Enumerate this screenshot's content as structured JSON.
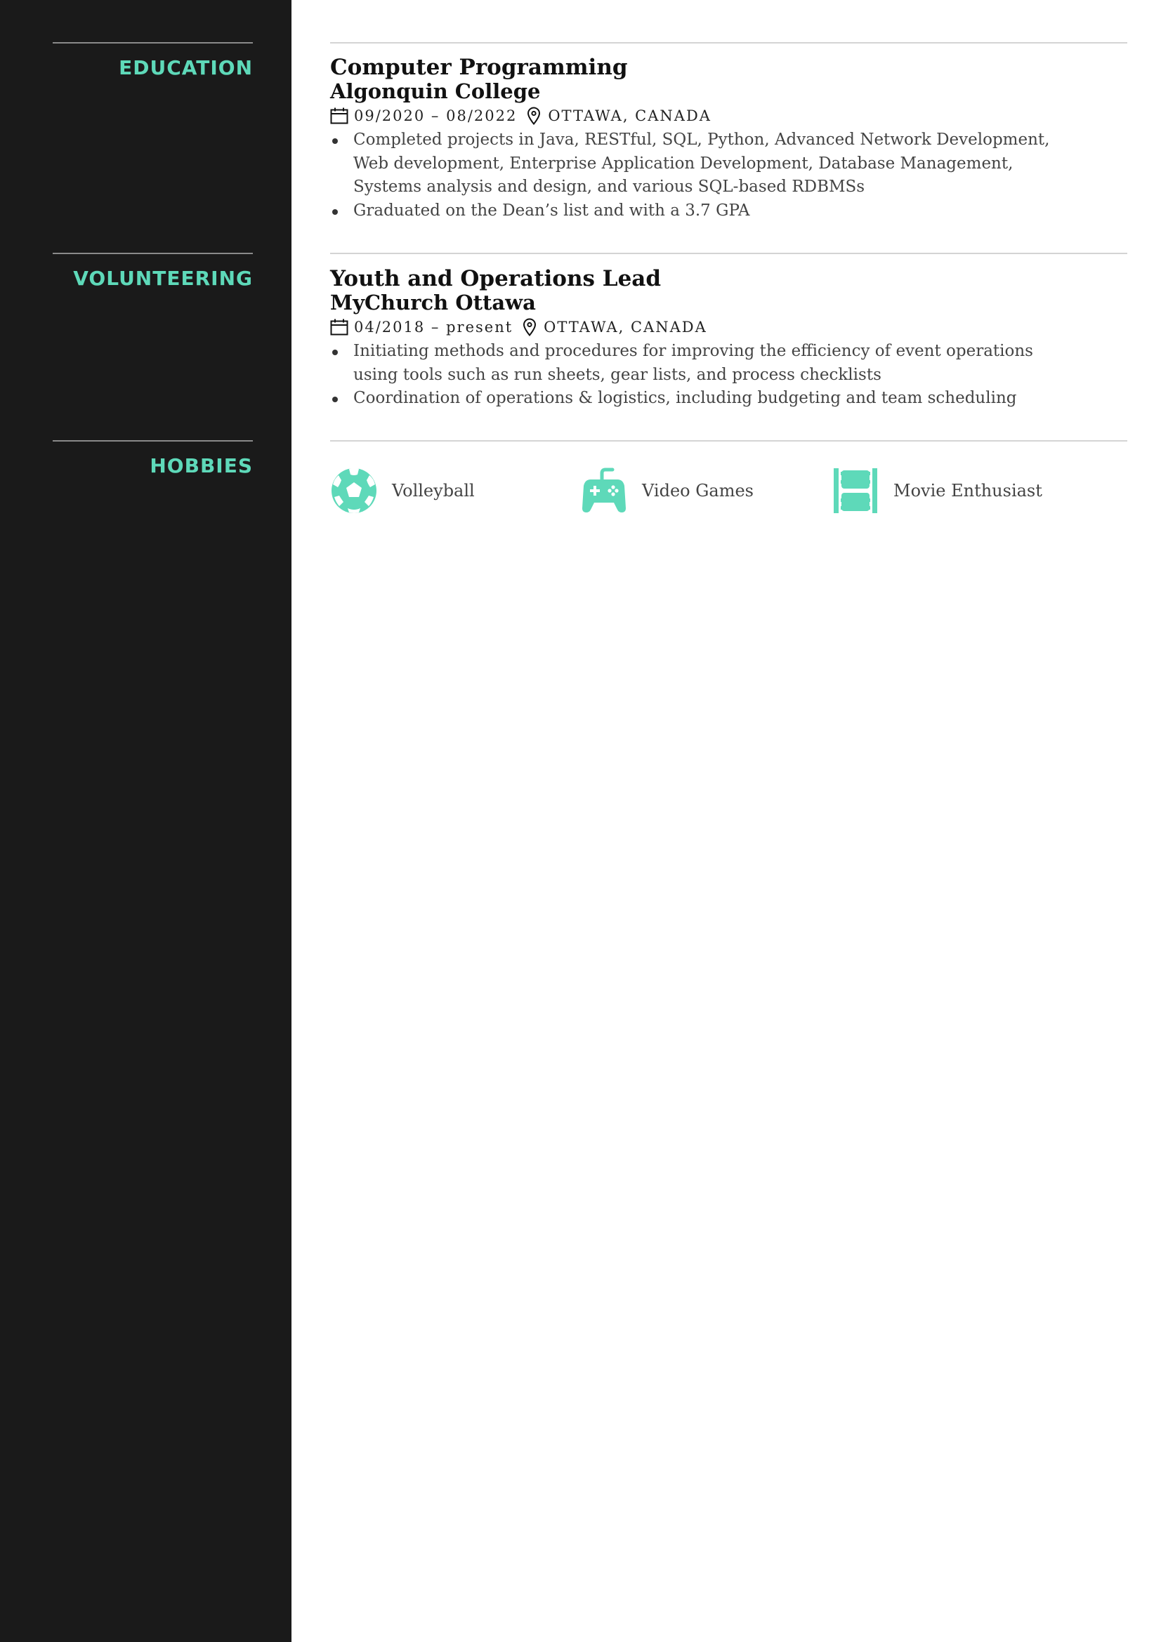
{
  "colors": {
    "sidebar_bg": "#1a1a1a",
    "accent": "#5ed9b9",
    "rule": "#d4d4d4"
  },
  "sections": {
    "education": "EDUCATION",
    "volunteering": "VOLUNTEERING",
    "hobbies": "HOBBIES"
  },
  "education": {
    "title": "Computer Programming",
    "org": "Algonquin College",
    "dates": "09/2020 – 08/2022",
    "location": "OTTAWA, CANADA",
    "bullets": [
      "Completed projects in Java, RESTful, SQL, Python, Advanced Network Development, Web development, Enterprise Application Development, Database Management, Systems analysis and design, and various SQL-based RDBMSs",
      "Graduated on the Dean’s list and with a 3.7 GPA"
    ]
  },
  "volunteering": {
    "title": "Youth and Operations Lead",
    "org": "MyChurch Ottawa",
    "dates": "04/2018 – present",
    "location": "OTTAWA, CANADA",
    "bullets": [
      "Initiating methods and procedures for improving the efficiency of event operations using tools such as run sheets, gear lists, and process checklists",
      "Coordination of operations & logistics, including budgeting and team scheduling"
    ]
  },
  "hobbies": [
    {
      "icon": "soccer-ball-icon",
      "label": "Volleyball"
    },
    {
      "icon": "gamepad-icon",
      "label": "Video Games"
    },
    {
      "icon": "film-strip-icon",
      "label": "Movie Enthusiast"
    }
  ]
}
